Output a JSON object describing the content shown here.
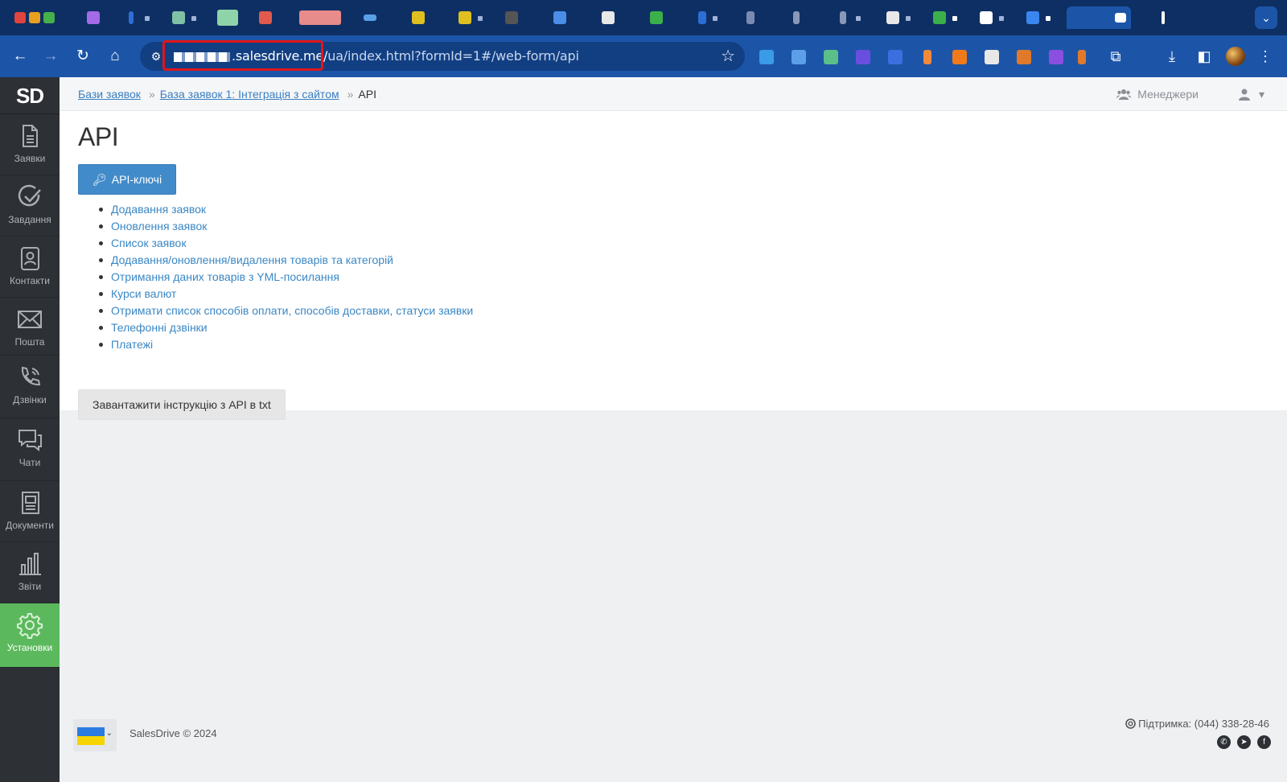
{
  "browser": {
    "url_host": ".salesdrive.me/",
    "url_path": "ua/index.html?formId=1#/web-form/api",
    "bookmark_icon": "star-icon",
    "colors": {
      "tabstrip": "#0e2f63",
      "toolbar": "#1c55a8",
      "omnibox": "#123f82",
      "url_highlight": "#e0161c"
    }
  },
  "app": {
    "logo": "SD",
    "sidebar": [
      {
        "label": "Заявки",
        "icon": "document-icon"
      },
      {
        "label": "Завдання",
        "icon": "checkmark-circle-icon"
      },
      {
        "label": "Контакти",
        "icon": "contacts-book-icon"
      },
      {
        "label": "Пошта",
        "icon": "envelope-icon"
      },
      {
        "label": "Дзвінки",
        "icon": "phone-icon"
      },
      {
        "label": "Чати",
        "icon": "chat-bubbles-icon"
      },
      {
        "label": "Документи",
        "icon": "documents-icon"
      },
      {
        "label": "Звіти",
        "icon": "bar-chart-icon"
      },
      {
        "label": "Установки",
        "icon": "gear-icon",
        "active": true
      }
    ],
    "accent_color": "#5cb85c"
  },
  "header": {
    "breadcrumb": {
      "item1": "Бази заявок",
      "item2": "База заявок 1: Інтеграція з сайтом",
      "current": "API",
      "separator": "»"
    },
    "managers_label": "Менеджери"
  },
  "main": {
    "title": "API",
    "api_keys_button": "API-ключі",
    "links": [
      "Додавання заявок",
      "Оновлення заявок",
      "Список заявок",
      "Додавання/оновлення/видалення товарів та категорій",
      "Отримання даних товарів з YML-посилання",
      "Курси валют",
      "Отримати список способів оплати, способів доставки, статуси заявки",
      "Телефонні дзвінки",
      "Платежі"
    ],
    "download_button": "Завантажити інструкцію з API в txt"
  },
  "footer": {
    "copyright": "SalesDrive © 2024",
    "support": "Підтримка: (044) 338-28-46"
  }
}
